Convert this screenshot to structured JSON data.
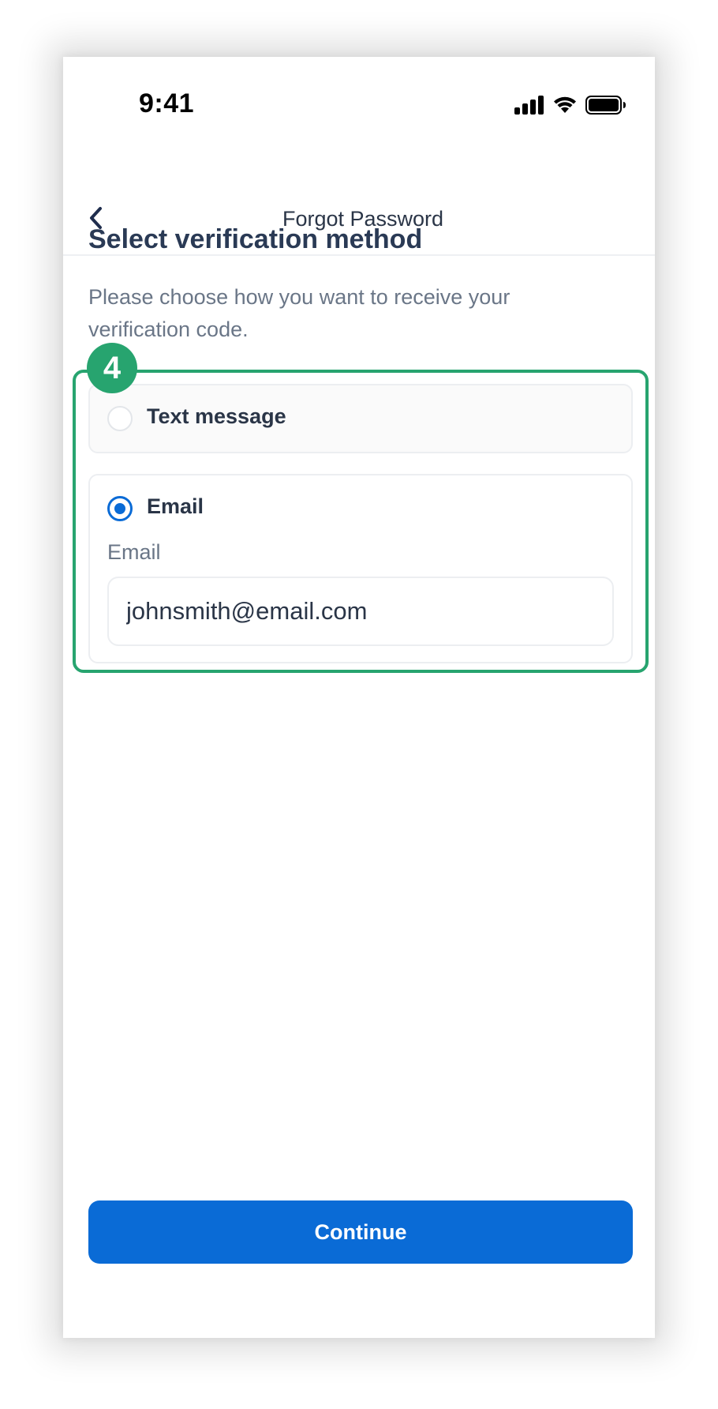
{
  "status_bar": {
    "time": "9:41",
    "icons": [
      "cellular-signal-icon",
      "wifi-icon",
      "battery-icon"
    ]
  },
  "nav": {
    "back_icon": "chevron-left-icon",
    "title": "Forgot Password"
  },
  "content": {
    "heading": "Select verification method",
    "subtext": "Please choose how you want to receive your verification code."
  },
  "annotation": {
    "step_number": "4",
    "color": "#27a46f"
  },
  "options": {
    "sms": {
      "label": "Text message",
      "selected": false
    },
    "email": {
      "label": "Email",
      "selected": true,
      "field_label": "Email",
      "value": "johnsmith@email.com"
    }
  },
  "actions": {
    "continue_label": "Continue"
  },
  "colors": {
    "primary": "#0a6bd6",
    "heading_text": "#2a3a55",
    "muted_text": "#6a7687",
    "highlight": "#27a46f"
  }
}
